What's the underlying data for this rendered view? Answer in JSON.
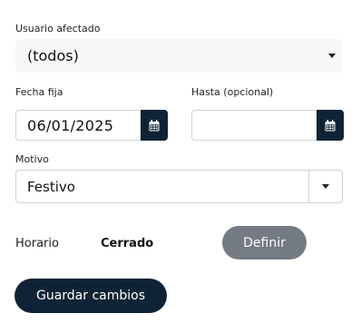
{
  "user_field": {
    "label": "Usuario afectado",
    "selected": "(todos)"
  },
  "date_fixed": {
    "label": "Fecha fija",
    "value": "06/01/2025",
    "button_icon": "calendar-icon"
  },
  "date_until": {
    "label": "Hasta (opcional)",
    "value": "",
    "button_icon": "calendar-icon"
  },
  "reason_field": {
    "label": "Motivo",
    "selected": "Festivo"
  },
  "schedule": {
    "label": "Horario",
    "value": "Cerrado",
    "define_button": "Definir"
  },
  "actions": {
    "save_button": "Guardar cambios"
  },
  "colors": {
    "primary": "#0f2336",
    "secondary_button": "#747b82",
    "field_border": "#cfd3d8"
  }
}
